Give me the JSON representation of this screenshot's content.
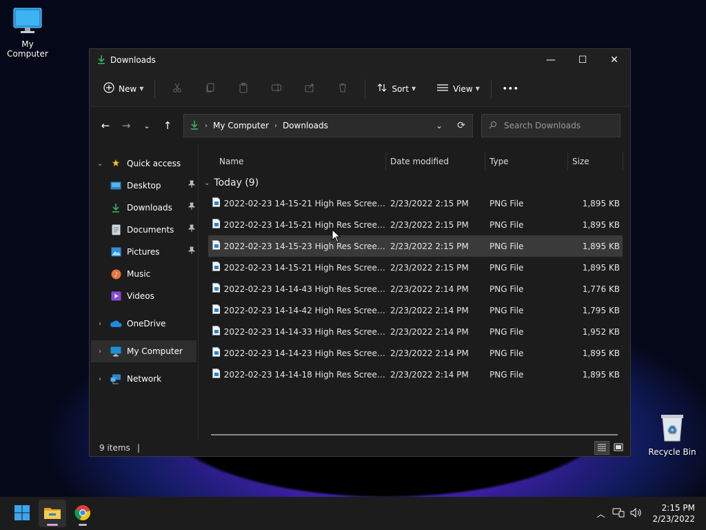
{
  "desktop": {
    "icons": [
      {
        "label": "My Computer"
      },
      {
        "label": "Recycle Bin"
      }
    ]
  },
  "window": {
    "title": "Downloads",
    "controls": {
      "minimize": "—",
      "maximize": "☐",
      "close": "✕"
    }
  },
  "toolbar": {
    "new_label": "New",
    "sort_label": "Sort",
    "view_label": "View",
    "more_label": "•••"
  },
  "address": {
    "crumbs": [
      "My Computer",
      "Downloads"
    ]
  },
  "search": {
    "placeholder": "Search Downloads"
  },
  "sidebar": {
    "items": [
      {
        "label": "Quick access"
      },
      {
        "label": "Desktop"
      },
      {
        "label": "Downloads"
      },
      {
        "label": "Documents"
      },
      {
        "label": "Pictures"
      },
      {
        "label": "Music"
      },
      {
        "label": "Videos"
      },
      {
        "label": "OneDrive"
      },
      {
        "label": "My Computer"
      },
      {
        "label": "Network"
      }
    ]
  },
  "columns": {
    "name": "Name",
    "date": "Date modified",
    "type": "Type",
    "size": "Size"
  },
  "group": {
    "label": "Today (9)"
  },
  "files": [
    {
      "name": "2022-02-23 14-15-21 High Res Screensho...",
      "date": "2/23/2022 2:15 PM",
      "type": "PNG File",
      "size": "1,895 KB"
    },
    {
      "name": "2022-02-23 14-15-21 High Res Screensho...",
      "date": "2/23/2022 2:15 PM",
      "type": "PNG File",
      "size": "1,895 KB"
    },
    {
      "name": "2022-02-23 14-15-23 High Res Screensho...",
      "date": "2/23/2022 2:15 PM",
      "type": "PNG File",
      "size": "1,895 KB"
    },
    {
      "name": "2022-02-23 14-15-21 High Res Screensho...",
      "date": "2/23/2022 2:15 PM",
      "type": "PNG File",
      "size": "1,895 KB"
    },
    {
      "name": "2022-02-23 14-14-43 High Res Screensho...",
      "date": "2/23/2022 2:14 PM",
      "type": "PNG File",
      "size": "1,776 KB"
    },
    {
      "name": "2022-02-23 14-14-42 High Res Screensho...",
      "date": "2/23/2022 2:14 PM",
      "type": "PNG File",
      "size": "1,795 KB"
    },
    {
      "name": "2022-02-23 14-14-33 High Res Screensho...",
      "date": "2/23/2022 2:14 PM",
      "type": "PNG File",
      "size": "1,952 KB"
    },
    {
      "name": "2022-02-23 14-14-23 High Res Screensho...",
      "date": "2/23/2022 2:14 PM",
      "type": "PNG File",
      "size": "1,895 KB"
    },
    {
      "name": "2022-02-23 14-14-18 High Res Screensho...",
      "date": "2/23/2022 2:14 PM",
      "type": "PNG File",
      "size": "1,895 KB"
    }
  ],
  "status": {
    "items_count": "9 items",
    "cursor_bar": "|"
  },
  "taskbar": {
    "time": "2:15 PM",
    "date": "2/23/2022"
  },
  "colors": {
    "accent": "#0a84c8",
    "folder": "#f2c14e",
    "download_green": "#2fb36a"
  }
}
